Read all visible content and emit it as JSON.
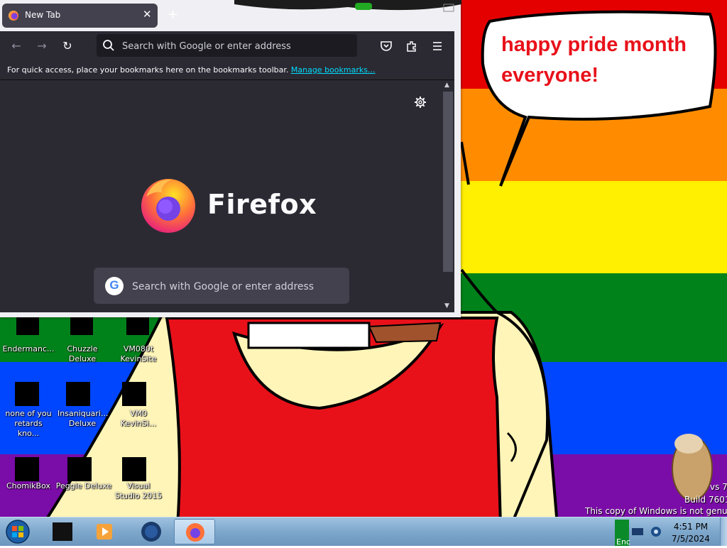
{
  "browser": {
    "tab_title": "New Tab",
    "tab_close_icon": "close-icon",
    "new_tab_symbol": "+",
    "url_placeholder": "Search with Google or enter address",
    "bookmarks_message": "For quick access, place your bookmarks here on the bookmarks toolbar.",
    "bookmarks_link": "Manage bookmarks...",
    "brand_wordmark": "Firefox",
    "content_search_placeholder": "Search with Google or enter address",
    "google_letter": "G"
  },
  "wallpaper": {
    "speech_line1": "happy pride month",
    "speech_line2": "everyone!",
    "stripe_colors": [
      "#e50000",
      "#ff8c00",
      "#ffef00",
      "#00821b",
      "#0046ff",
      "#7a0ca7"
    ]
  },
  "desktop_icons": [
    {
      "label": "Endermanc..."
    },
    {
      "label": "Chuzzle Deluxe"
    },
    {
      "label": "VM080t KevinSite"
    },
    {
      "label": "none of you retards kno..."
    },
    {
      "label": "Insaniquari... Deluxe"
    },
    {
      "label": "VM0 KevinSi..."
    },
    {
      "label": "ChomikBox"
    },
    {
      "label": "Peggle Deluxe"
    },
    {
      "label": "Visual Studio 2015"
    }
  ],
  "watermark": {
    "line1": "vs 7",
    "line2": "Build 7601",
    "line3": "This copy of Windows is not genuine"
  },
  "taskbar": {
    "tray_lang": "Enc",
    "time": "4:51 PM",
    "date": "7/5/2024"
  }
}
